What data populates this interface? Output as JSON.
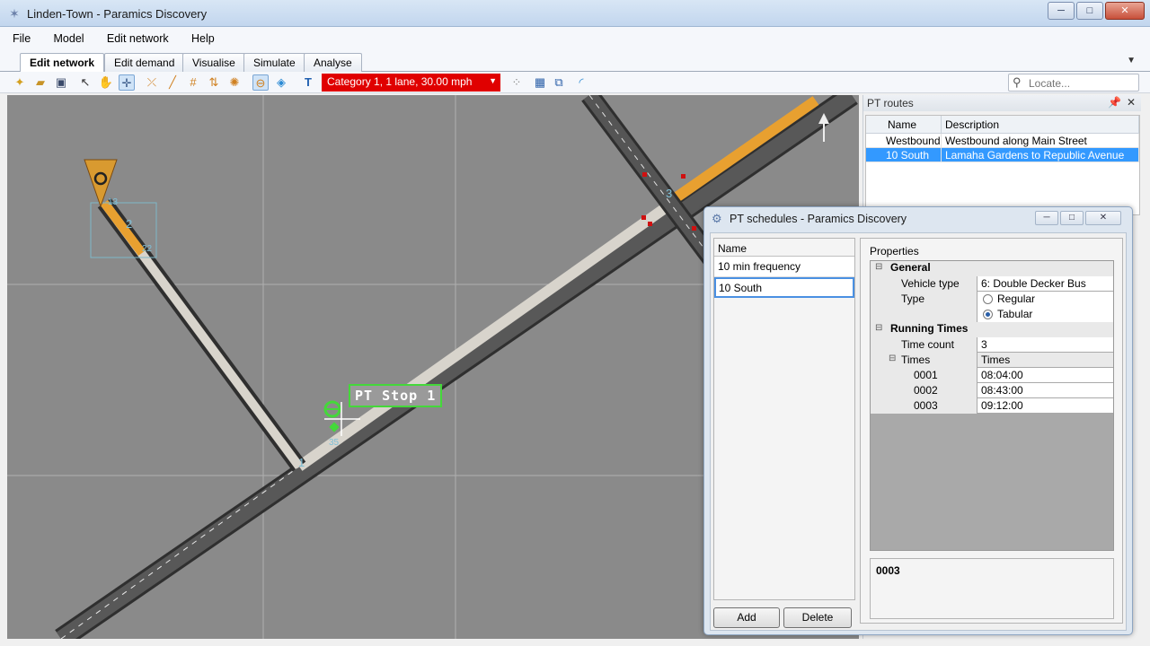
{
  "window": {
    "title": "Linden-Town - Paramics Discovery",
    "minimize": "─",
    "maximize": "□",
    "close": "✕"
  },
  "menu": [
    "File",
    "Model",
    "Edit network",
    "Help"
  ],
  "tabs": [
    "Edit network",
    "Edit demand",
    "Visualise",
    "Simulate",
    "Analyse"
  ],
  "toolbar": {
    "category": "Category 1, 1 lane, 30.00 mph",
    "locate_placeholder": "Locate..."
  },
  "map": {
    "stop_label": "PT Stop 1",
    "node_labels": [
      "1",
      "2",
      "3",
      "13",
      "22",
      "35"
    ],
    "road_color": "#d8d4cc",
    "highlight_color": "#e8a030"
  },
  "pt_routes": {
    "title": "PT routes",
    "columns": [
      "Name",
      "Description"
    ],
    "rows": [
      {
        "name": "Westbound",
        "description": "Westbound along Main Street"
      },
      {
        "name": "10 South",
        "description": "Lamaha Gardens to Republic Avenue"
      }
    ]
  },
  "schedules": {
    "title": "PT schedules - Paramics Discovery",
    "names_header": "Name",
    "names": [
      "10 min frequency",
      "10 South"
    ],
    "add": "Add",
    "delete": "Delete",
    "properties_title": "Properties",
    "general": "General",
    "vehicle_type_label": "Vehicle type",
    "vehicle_type_value": "6: Double Decker Bus",
    "type_label": "Type",
    "type_options": [
      "Regular",
      "Tabular"
    ],
    "running_times": "Running Times",
    "time_count_label": "Time count",
    "time_count_value": "3",
    "times_label": "Times",
    "times_value": "Times",
    "times": [
      {
        "id": "0001",
        "time": "08:04:00"
      },
      {
        "id": "0002",
        "time": "08:43:00"
      },
      {
        "id": "0003",
        "time": "09:12:00"
      }
    ],
    "description": "0003"
  }
}
